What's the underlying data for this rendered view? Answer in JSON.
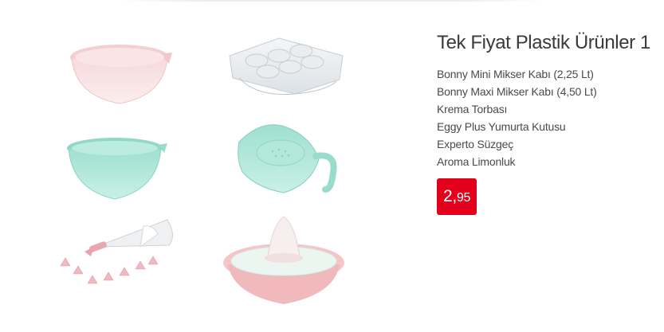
{
  "product": {
    "title": "Tek Fiyat Plastik Ürünler 1",
    "items": [
      "Bonny Mini Mikser Kabı (2,25 Lt)",
      "Bonny Maxi Mikser Kabı (4,50 Lt)",
      "Krema Torbası",
      "Eggy Plus Yumurta Kutusu",
      "Experto Süzgeç",
      "Aroma Limonluk"
    ],
    "price": {
      "integer": "2",
      "separator": ",",
      "decimal": "95"
    }
  },
  "colors": {
    "price_badge": "#e2001a",
    "pink": "#f2c9cc",
    "mint": "#a9e4d6"
  }
}
